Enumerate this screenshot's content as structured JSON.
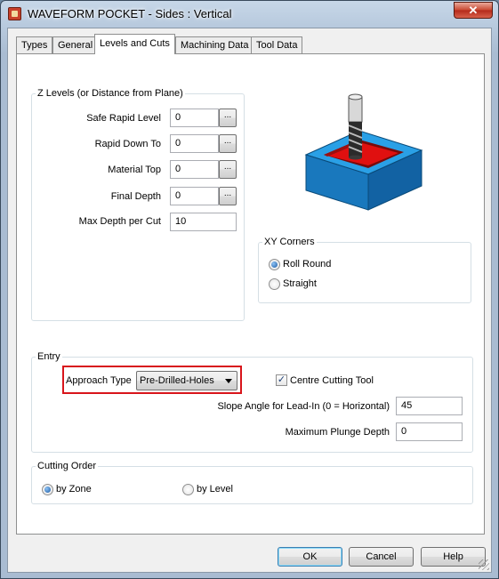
{
  "window": {
    "title": "WAVEFORM POCKET - Sides : Vertical",
    "close_label": "✕"
  },
  "tabs": [
    {
      "label": "Types"
    },
    {
      "label": "General"
    },
    {
      "label": "Levels and Cuts",
      "active": true
    },
    {
      "label": "Machining Data"
    },
    {
      "label": "Tool Data"
    }
  ],
  "z_levels": {
    "legend": "Z Levels (or Distance from Plane)",
    "fields": [
      {
        "label": "Safe Rapid Level",
        "value": "0",
        "browse": "..."
      },
      {
        "label": "Rapid Down To",
        "value": "0",
        "browse": "..."
      },
      {
        "label": "Material Top",
        "value": "0",
        "browse": "..."
      },
      {
        "label": "Final Depth",
        "value": "0",
        "browse": "..."
      },
      {
        "label": "Max Depth per Cut",
        "value": "10"
      }
    ]
  },
  "xy_corners": {
    "legend": "XY Corners",
    "options": [
      {
        "label": "Roll Round",
        "selected": true
      },
      {
        "label": "Straight",
        "selected": false
      }
    ]
  },
  "entry": {
    "legend": "Entry",
    "approach_type_label": "Approach Type",
    "approach_type_value": "Pre-Drilled-Holes",
    "centre_cutting_label": "Centre Cutting Tool",
    "centre_cutting_checked": true,
    "slope_angle_label": "Slope Angle for Lead-In (0 = Horizontal)",
    "slope_angle_value": "45",
    "max_plunge_label": "Maximum Plunge Depth",
    "max_plunge_value": "0"
  },
  "cutting_order": {
    "legend": "Cutting Order",
    "options": [
      {
        "label": "by Zone",
        "selected": true
      },
      {
        "label": "by Level",
        "selected": false
      }
    ]
  },
  "buttons": {
    "ok": "OK",
    "cancel": "Cancel",
    "help": "Help"
  },
  "colors": {
    "highlight": "#d8151b",
    "pocket_block": "#1e8fd6",
    "pocket_floor": "#e01010"
  }
}
